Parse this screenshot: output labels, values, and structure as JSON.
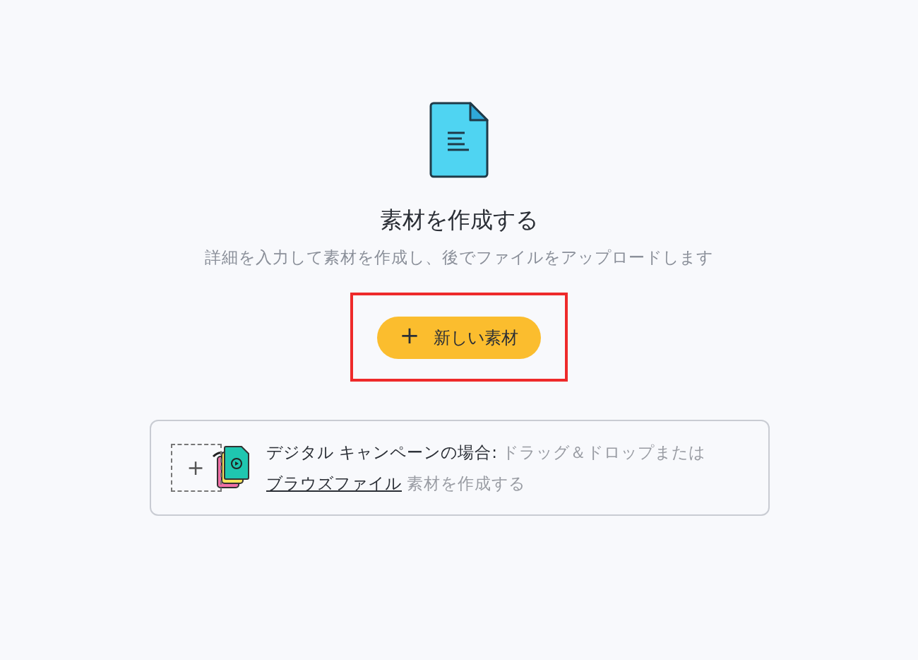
{
  "title": "素材を作成する",
  "subtitle": "詳細を入力して素材を作成し、後でファイルをアップロードします",
  "new_button": {
    "icon": "+",
    "label": "新しい素材",
    "highlighted": true
  },
  "drop_zone": {
    "plus": "+",
    "lead": "デジタル キャンペーンの場合:",
    "text": "ドラッグ＆ドロップまたは",
    "link": "ブラウズファイル",
    "trail": "素材を作成する"
  }
}
